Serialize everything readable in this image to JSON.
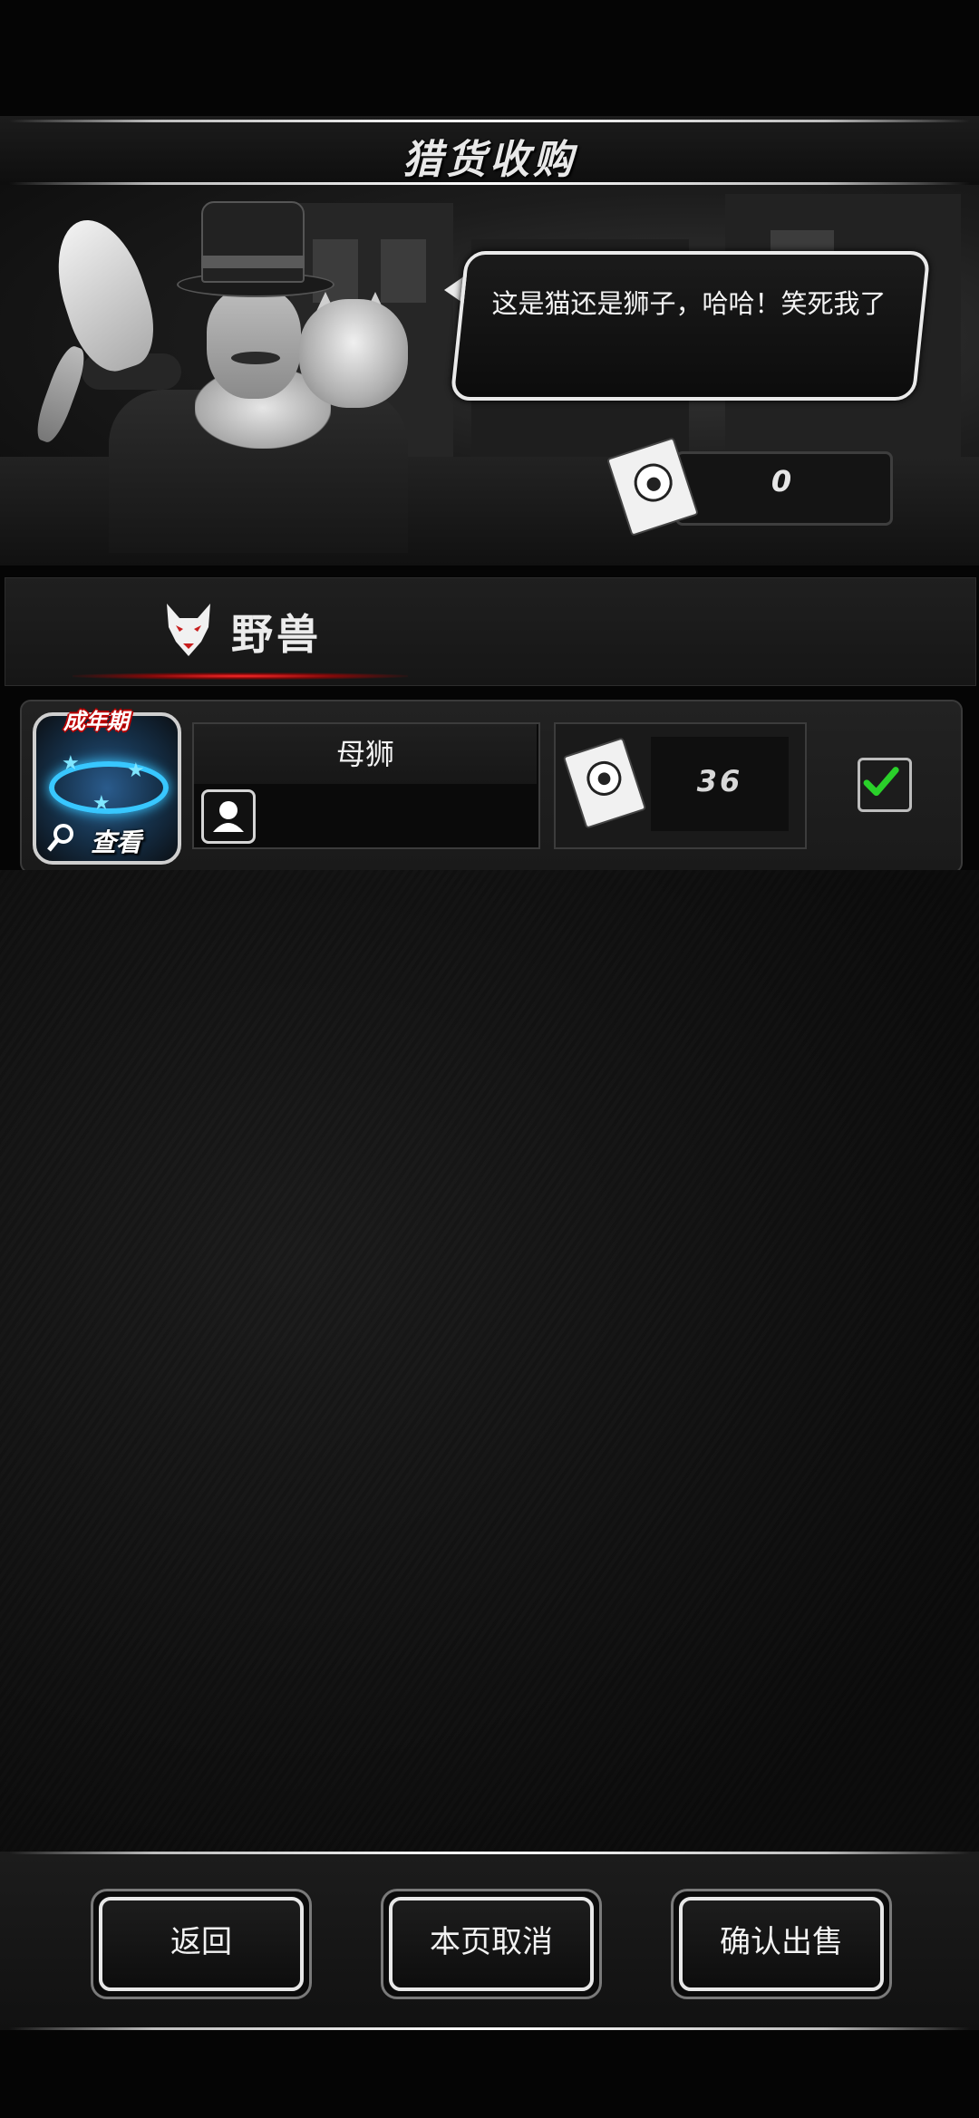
{
  "header": {
    "title": "猎货收购"
  },
  "dialog": {
    "speech": "这是猫还是狮子，哈哈！笑死我了"
  },
  "currency": {
    "icon": "paw-certificate-icon",
    "value": "0"
  },
  "category_tab": {
    "icon": "wolf-icon",
    "label": "野兽",
    "accent_color": "#e02424"
  },
  "items": [
    {
      "stage_badge": "成年期",
      "view_label": "查看",
      "name": "母狮",
      "price": "36",
      "checked": true
    }
  ],
  "footer": {
    "back_label": "返回",
    "cancel_page_label": "本页取消",
    "confirm_sell_label": "确认出售"
  },
  "colors": {
    "check_green": "#2ad02a",
    "glow_blue": "#38c7ff"
  }
}
